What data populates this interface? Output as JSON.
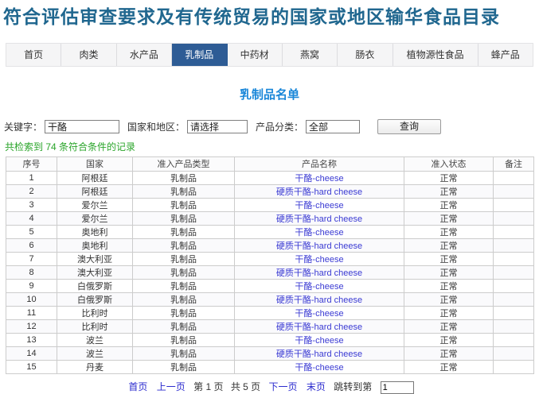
{
  "page": {
    "title": "符合评估审查要求及有传统贸易的国家或地区输华食品目录"
  },
  "nav": {
    "tabs": [
      {
        "label": "首页",
        "active": false
      },
      {
        "label": "肉类",
        "active": false
      },
      {
        "label": "水产品",
        "active": false
      },
      {
        "label": "乳制品",
        "active": true
      },
      {
        "label": "中药材",
        "active": false
      },
      {
        "label": "燕窝",
        "active": false
      },
      {
        "label": "肠衣",
        "active": false
      },
      {
        "label": "植物源性食品",
        "active": false
      },
      {
        "label": "蜂产品",
        "active": false
      }
    ]
  },
  "section": {
    "heading": "乳制品名单"
  },
  "search": {
    "keyword_label": "关键字：",
    "keyword_value": "干酪",
    "country_label": "国家和地区：",
    "country_value": "请选择",
    "category_label": "产品分类：",
    "category_value": "全部",
    "query_button": "查询",
    "result_count": "共检索到 74 条符合条件的记录"
  },
  "table": {
    "headers": [
      "序号",
      "国家",
      "准入产品类型",
      "产品名称",
      "准入状态",
      "备注"
    ],
    "rows": [
      {
        "no": "1",
        "country": "阿根廷",
        "type": "乳制品",
        "name": "干酪-cheese",
        "status": "正常",
        "remark": ""
      },
      {
        "no": "2",
        "country": "阿根廷",
        "type": "乳制品",
        "name": "硬质干酪-hard cheese",
        "status": "正常",
        "remark": ""
      },
      {
        "no": "3",
        "country": "爱尔兰",
        "type": "乳制品",
        "name": "干酪-cheese",
        "status": "正常",
        "remark": ""
      },
      {
        "no": "4",
        "country": "爱尔兰",
        "type": "乳制品",
        "name": "硬质干酪-hard cheese",
        "status": "正常",
        "remark": ""
      },
      {
        "no": "5",
        "country": "奥地利",
        "type": "乳制品",
        "name": "干酪-cheese",
        "status": "正常",
        "remark": ""
      },
      {
        "no": "6",
        "country": "奥地利",
        "type": "乳制品",
        "name": "硬质干酪-hard cheese",
        "status": "正常",
        "remark": ""
      },
      {
        "no": "7",
        "country": "澳大利亚",
        "type": "乳制品",
        "name": "干酪-cheese",
        "status": "正常",
        "remark": ""
      },
      {
        "no": "8",
        "country": "澳大利亚",
        "type": "乳制品",
        "name": "硬质干酪-hard cheese",
        "status": "正常",
        "remark": ""
      },
      {
        "no": "9",
        "country": "白俄罗斯",
        "type": "乳制品",
        "name": "干酪-cheese",
        "status": "正常",
        "remark": ""
      },
      {
        "no": "10",
        "country": "白俄罗斯",
        "type": "乳制品",
        "name": "硬质干酪-hard cheese",
        "status": "正常",
        "remark": ""
      },
      {
        "no": "11",
        "country": "比利时",
        "type": "乳制品",
        "name": "干酪-cheese",
        "status": "正常",
        "remark": ""
      },
      {
        "no": "12",
        "country": "比利时",
        "type": "乳制品",
        "name": "硬质干酪-hard cheese",
        "status": "正常",
        "remark": ""
      },
      {
        "no": "13",
        "country": "波兰",
        "type": "乳制品",
        "name": "干酪-cheese",
        "status": "正常",
        "remark": ""
      },
      {
        "no": "14",
        "country": "波兰",
        "type": "乳制品",
        "name": "硬质干酪-hard cheese",
        "status": "正常",
        "remark": ""
      },
      {
        "no": "15",
        "country": "丹麦",
        "type": "乳制品",
        "name": "干酪-cheese",
        "status": "正常",
        "remark": ""
      }
    ]
  },
  "pagination": {
    "first": "首页",
    "prev": "上一页",
    "current": "第 1 页",
    "total": "共 5 页",
    "next": "下一页",
    "last": "末页",
    "jump_label": "跳转到第",
    "jump_value": "1"
  },
  "colors": {
    "title_text": "#20678f",
    "active_tab_bg": "#2e5c95",
    "section_heading": "#1a87d9",
    "result_count_green": "#2aa52a",
    "product_link": "#3a3ad3",
    "pagination_link": "#2a2ace"
  }
}
